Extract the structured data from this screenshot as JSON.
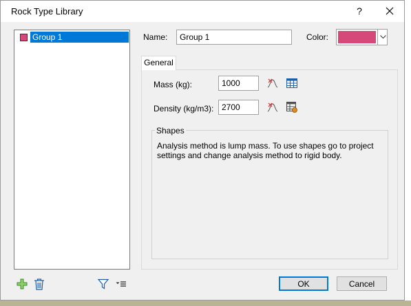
{
  "window": {
    "title": "Rock Type Library"
  },
  "tree": {
    "items": [
      {
        "label": "Group 1",
        "color": "#d24a7a"
      }
    ]
  },
  "form": {
    "name_label": "Name:",
    "name_value": "Group 1",
    "color_label": "Color:",
    "color_value": "#d6477a"
  },
  "tabs": [
    {
      "label": "General"
    }
  ],
  "general": {
    "mass_label": "Mass (kg):",
    "mass_value": "1000",
    "density_label": "Density (kg/m3):",
    "density_value": "2700"
  },
  "shapes": {
    "title": "Shapes",
    "message": "Analysis method is lump mass. To use shapes go to project settings and change analysis method to rigid body."
  },
  "buttons": {
    "ok": "OK",
    "cancel": "Cancel"
  },
  "icons": {
    "help": "question-icon",
    "close": "close-icon",
    "add": "add-plus-icon",
    "delete": "trash-icon",
    "filter": "filter-icon",
    "sort": "sort-menu-icon",
    "statistics": "statistics-curve-icon",
    "table": "table-icon"
  }
}
